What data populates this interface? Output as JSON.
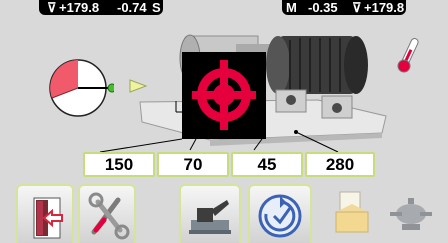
{
  "status_bar": {
    "left": {
      "angle_value": "+179.8",
      "offset_value": "-0.74",
      "mode": "S"
    },
    "right": {
      "mode": "M",
      "offset_value": "-0.35",
      "angle_value": "+179.8"
    }
  },
  "measurements": [
    {
      "value": "150"
    },
    {
      "value": "70"
    },
    {
      "value": "45"
    },
    {
      "value": "280"
    }
  ],
  "icons": {
    "exit": "exit-door-icon",
    "tools": "tools-icon",
    "machine_setup": "machine-setup-icon",
    "rotation": "rotation-icon",
    "report": "report-icon",
    "machine_generic": "machine-generic-icon",
    "temperature": "thermometer-icon",
    "target": "target-icon",
    "angle_gauge": "angle-gauge-icon"
  },
  "colors": {
    "accent_red": "#e5003d",
    "highlight_green": "#c7dc7a",
    "status_bg": "#000000"
  }
}
